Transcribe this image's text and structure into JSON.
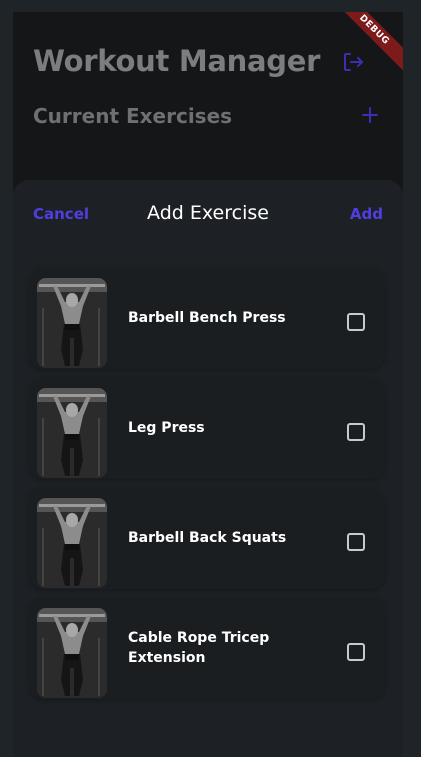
{
  "header": {
    "title": "Workout Manager",
    "subtitle": "Current Exercises",
    "logout_icon": "logout-icon",
    "add_icon": "plus-icon"
  },
  "debug_banner": "DEBUG",
  "sheet": {
    "cancel_label": "Cancel",
    "title": "Add Exercise",
    "add_label": "Add"
  },
  "exercises": [
    {
      "name": "Barbell Bench Press",
      "checked": false
    },
    {
      "name": "Leg Press",
      "checked": false
    },
    {
      "name": "Barbell Back Squats",
      "checked": false
    },
    {
      "name": "Cable Rope Tricep Extension",
      "checked": false
    }
  ],
  "colors": {
    "accent": "#4f3fe0",
    "background": "#141618",
    "sheet": "#1d2125",
    "debug": "#7d1a1a"
  }
}
